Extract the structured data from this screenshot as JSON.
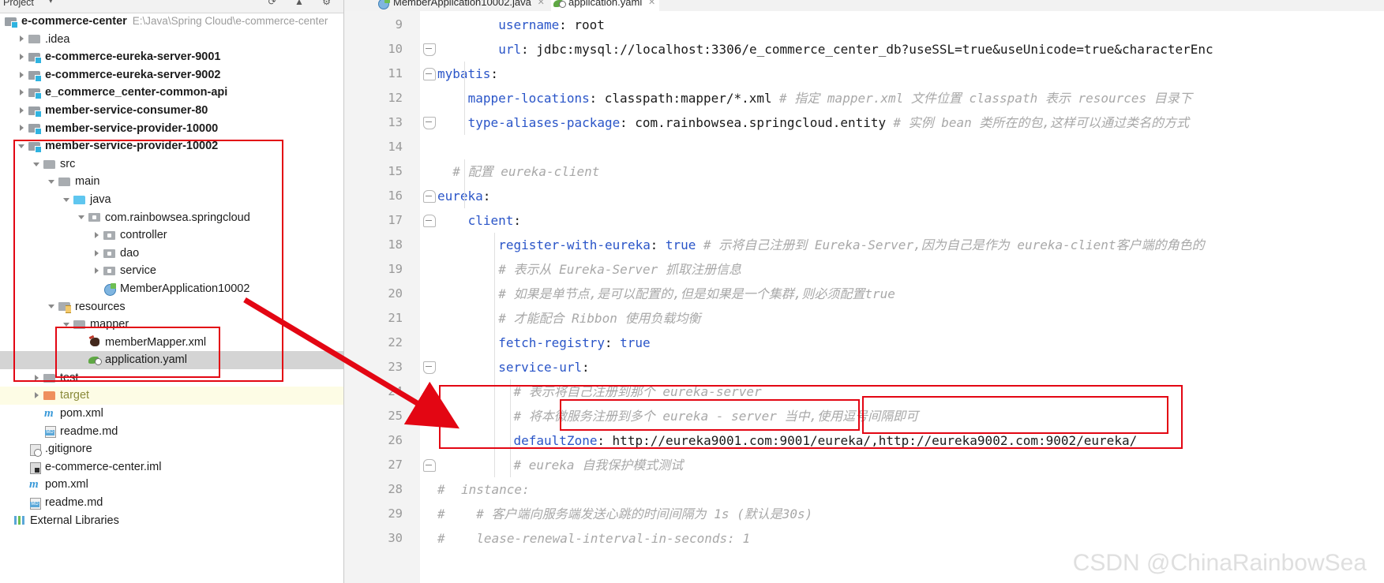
{
  "project_panel": {
    "header": {
      "title": "Project",
      "caret": "▾",
      "icons": "⟳ ▲ ⚙"
    },
    "root": {
      "label": "e-commerce-center",
      "path": "E:\\Java\\Spring Cloud\\e-commerce-center"
    },
    "items": [
      {
        "label": ".idea",
        "indent": 1,
        "arrow": "right",
        "icon": "folder",
        "style": "plain"
      },
      {
        "label": "e-commerce-eureka-server-9001",
        "indent": 1,
        "arrow": "right",
        "icon": "module",
        "style": "bold"
      },
      {
        "label": "e-commerce-eureka-server-9002",
        "indent": 1,
        "arrow": "right",
        "icon": "module",
        "style": "bold"
      },
      {
        "label": "e_commerce_center-common-api",
        "indent": 1,
        "arrow": "right",
        "icon": "module",
        "style": "bold"
      },
      {
        "label": "member-service-consumer-80",
        "indent": 1,
        "arrow": "right",
        "icon": "module",
        "style": "bold"
      },
      {
        "label": "member-service-provider-10000",
        "indent": 1,
        "arrow": "right",
        "icon": "module",
        "style": "bold"
      },
      {
        "label": "member-service-provider-10002",
        "indent": 1,
        "arrow": "down",
        "icon": "module",
        "style": "bold"
      },
      {
        "label": "src",
        "indent": 2,
        "arrow": "down",
        "icon": "folder",
        "style": "plain"
      },
      {
        "label": "main",
        "indent": 3,
        "arrow": "down",
        "icon": "folder",
        "style": "plain"
      },
      {
        "label": "java",
        "indent": 4,
        "arrow": "down",
        "icon": "folder-blue",
        "style": "plain"
      },
      {
        "label": "com.rainbowsea.springcloud",
        "indent": 5,
        "arrow": "down",
        "icon": "pkg",
        "style": "plain"
      },
      {
        "label": "controller",
        "indent": 6,
        "arrow": "right",
        "icon": "pkg",
        "style": "plain"
      },
      {
        "label": "dao",
        "indent": 6,
        "arrow": "right",
        "icon": "pkg",
        "style": "plain"
      },
      {
        "label": "service",
        "indent": 6,
        "arrow": "right",
        "icon": "pkg",
        "style": "plain"
      },
      {
        "label": "MemberApplication10002",
        "indent": 6,
        "arrow": "none",
        "icon": "javacls",
        "style": "plain"
      },
      {
        "label": "resources",
        "indent": 3,
        "arrow": "down",
        "icon": "resfolder",
        "style": "plain"
      },
      {
        "label": "mapper",
        "indent": 4,
        "arrow": "down",
        "icon": "folder",
        "style": "plain"
      },
      {
        "label": "memberMapper.xml",
        "indent": 5,
        "arrow": "none",
        "icon": "xmlf",
        "style": "plain"
      },
      {
        "label": "application.yaml",
        "indent": 5,
        "arrow": "none",
        "icon": "yamlf",
        "style": "selected"
      },
      {
        "label": "test",
        "indent": 2,
        "arrow": "right",
        "icon": "folder",
        "style": "plain"
      },
      {
        "label": "target",
        "indent": 2,
        "arrow": "right",
        "icon": "folder-orange",
        "style": "olive"
      },
      {
        "label": "pom.xml",
        "indent": 2,
        "arrow": "none",
        "icon": "maven",
        "style": "plain"
      },
      {
        "label": "readme.md",
        "indent": 2,
        "arrow": "none",
        "icon": "mdf",
        "style": "plain"
      },
      {
        "label": ".gitignore",
        "indent": 1,
        "arrow": "none",
        "icon": "gitf",
        "style": "plain"
      },
      {
        "label": "e-commerce-center.iml",
        "indent": 1,
        "arrow": "none",
        "icon": "imlf",
        "style": "plain"
      },
      {
        "label": "pom.xml",
        "indent": 1,
        "arrow": "none",
        "icon": "maven",
        "style": "plain"
      },
      {
        "label": "readme.md",
        "indent": 1,
        "arrow": "none",
        "icon": "mdf",
        "style": "plain"
      },
      {
        "label": "External Libraries",
        "indent": 0,
        "arrow": "none",
        "icon": "extlib",
        "style": "plain"
      }
    ]
  },
  "editor": {
    "tabs": [
      {
        "label": "MemberApplication10002.java",
        "icon": "java-class-icon",
        "active": false,
        "close": "✕"
      },
      {
        "label": "application.yaml",
        "icon": "yaml-file-icon",
        "active": true,
        "close": "✕"
      }
    ],
    "lines": [
      {
        "n": "9",
        "indent": 4,
        "fold": "none",
        "segs": [
          {
            "t": "username",
            "c": "k"
          },
          {
            "t": ": ",
            "c": "v"
          },
          {
            "t": "root",
            "c": "v"
          }
        ]
      },
      {
        "n": "10",
        "indent": 4,
        "fold": "minus",
        "segs": [
          {
            "t": "url",
            "c": "k"
          },
          {
            "t": ": ",
            "c": "v"
          },
          {
            "t": "jdbc:mysql://localhost:3306/e_commerce_center_db?useSSL=true&useUnicode=true&characterEnc",
            "c": "v"
          }
        ]
      },
      {
        "n": "11",
        "indent": 0,
        "fold": "minus-top",
        "segs": [
          {
            "t": "mybatis",
            "c": "k"
          },
          {
            "t": ":",
            "c": "v"
          }
        ]
      },
      {
        "n": "12",
        "indent": 2,
        "fold": "none",
        "segs": [
          {
            "t": "mapper-locations",
            "c": "k"
          },
          {
            "t": ": ",
            "c": "v"
          },
          {
            "t": "classpath:mapper/*.xml",
            "c": "v"
          },
          {
            "t": " # 指定 mapper.xml 文件位置 classpath 表示 resources 目录下",
            "c": "cm"
          }
        ]
      },
      {
        "n": "13",
        "indent": 2,
        "fold": "minus",
        "segs": [
          {
            "t": "type-aliases-package",
            "c": "k"
          },
          {
            "t": ": ",
            "c": "v"
          },
          {
            "t": "com.rainbowsea.springcloud.entity",
            "c": "v"
          },
          {
            "t": " # 实例 bean 类所在的包,这样可以通过类名的方式",
            "c": "cm"
          }
        ]
      },
      {
        "n": "14",
        "indent": 0,
        "fold": "none",
        "segs": []
      },
      {
        "n": "15",
        "indent": 1,
        "fold": "none",
        "segs": [
          {
            "t": "# 配置 eureka-client",
            "c": "cm"
          }
        ]
      },
      {
        "n": "16",
        "indent": 0,
        "fold": "minus-top",
        "segs": [
          {
            "t": "eureka",
            "c": "k"
          },
          {
            "t": ":",
            "c": "v"
          }
        ]
      },
      {
        "n": "17",
        "indent": 2,
        "fold": "minus-top",
        "segs": [
          {
            "t": "client",
            "c": "k"
          },
          {
            "t": ":",
            "c": "v"
          }
        ]
      },
      {
        "n": "18",
        "indent": 4,
        "fold": "none",
        "segs": [
          {
            "t": "register-with-eureka",
            "c": "k"
          },
          {
            "t": ": ",
            "c": "v"
          },
          {
            "t": "true",
            "c": "k"
          },
          {
            "t": " # 示将自己注册到 Eureka-Server,因为自己是作为 eureka-client客户端的角色的",
            "c": "cm"
          }
        ]
      },
      {
        "n": "19",
        "indent": 4,
        "fold": "none",
        "segs": [
          {
            "t": "# 表示从 Eureka-Server 抓取注册信息",
            "c": "cm"
          }
        ]
      },
      {
        "n": "20",
        "indent": 4,
        "fold": "none",
        "segs": [
          {
            "t": "# 如果是单节点,是可以配置的,但是如果是一个集群,则必须配置true",
            "c": "cm"
          }
        ]
      },
      {
        "n": "21",
        "indent": 4,
        "fold": "none",
        "segs": [
          {
            "t": "# 才能配合 Ribbon 使用负载均衡",
            "c": "cm"
          }
        ]
      },
      {
        "n": "22",
        "indent": 4,
        "fold": "none",
        "segs": [
          {
            "t": "fetch-registry",
            "c": "k"
          },
          {
            "t": ": ",
            "c": "v"
          },
          {
            "t": "true",
            "c": "k"
          }
        ]
      },
      {
        "n": "23",
        "indent": 4,
        "fold": "minus",
        "segs": [
          {
            "t": "service-url",
            "c": "k"
          },
          {
            "t": ":",
            "c": "v"
          }
        ]
      },
      {
        "n": "24",
        "indent": 5,
        "fold": "none",
        "segs": [
          {
            "t": "# 表示将自己注册到那个 eureka-server",
            "c": "cm"
          }
        ]
      },
      {
        "n": "25",
        "indent": 5,
        "fold": "none",
        "segs": [
          {
            "t": "# 将本微服务注册到多个 eureka - server 当中,使用逗号间隔即可",
            "c": "cm"
          }
        ]
      },
      {
        "n": "26",
        "indent": 5,
        "fold": "none",
        "segs": [
          {
            "t": "defaultZone",
            "c": "k"
          },
          {
            "t": ": ",
            "c": "v"
          },
          {
            "t": "http://eureka9001.com:9001/eureka/,http://eureka9002.com:9002/eureka/",
            "c": "v"
          }
        ]
      },
      {
        "n": "27",
        "indent": 5,
        "fold": "minus-top",
        "segs": [
          {
            "t": "# eureka 自我保护模式测试",
            "c": "cm"
          }
        ]
      },
      {
        "n": "28",
        "indent": 0,
        "fold": "none",
        "hash": "#",
        "segs": [
          {
            "t": "instance:",
            "c": "cm"
          }
        ]
      },
      {
        "n": "29",
        "indent": 1,
        "fold": "none",
        "hash": "#",
        "segs": [
          {
            "t": "# 客户端向服务端发送心跳的时间间隔为 1s (默认是30s)",
            "c": "cm"
          }
        ]
      },
      {
        "n": "30",
        "indent": 1,
        "fold": "none",
        "hash": "#",
        "segs": [
          {
            "t": "lease-renewal-interval-in-seconds: 1",
            "c": "cm"
          }
        ]
      }
    ]
  },
  "annotations": {
    "watermark": "CSDN @ChinaRainbowSea",
    "highlight_color": "#e30613"
  }
}
